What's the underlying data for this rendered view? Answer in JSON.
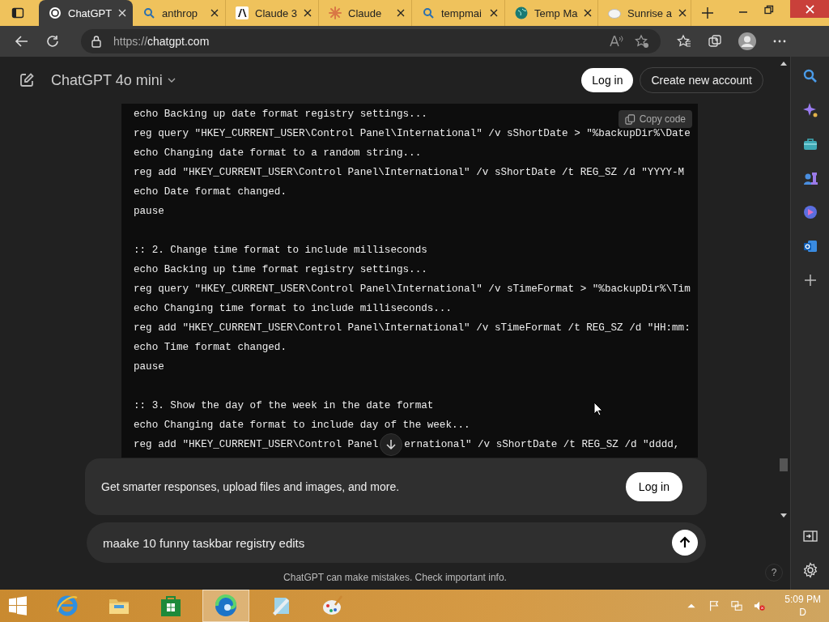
{
  "tabs": [
    {
      "label": "ChatGPT",
      "selected": true
    },
    {
      "label": "anthrop",
      "selected": false
    },
    {
      "label": "Claude 3",
      "selected": false
    },
    {
      "label": "Claude",
      "selected": false
    },
    {
      "label": "tempmai",
      "selected": false
    },
    {
      "label": "Temp Ma",
      "selected": false
    },
    {
      "label": "Sunrise a",
      "selected": false
    }
  ],
  "address_bar": {
    "scheme": "https://",
    "host": "chatgpt.com"
  },
  "header": {
    "model": "ChatGPT 4o mini",
    "login": "Log in",
    "signup": "Create new account"
  },
  "code": {
    "copy": "Copy code",
    "blocks": [
      [
        "echo Backing up date format registry settings...",
        "reg query \"HKEY_CURRENT_USER\\Control Panel\\International\" /v sShortDate > \"%backupDir%\\Date",
        "echo Changing date format to a random string...",
        "reg add \"HKEY_CURRENT_USER\\Control Panel\\International\" /v sShortDate /t REG_SZ /d \"YYYY-M",
        "echo Date format changed.",
        "pause"
      ],
      [
        ":: 2. Change time format to include milliseconds",
        "echo Backing up time format registry settings...",
        "reg query \"HKEY_CURRENT_USER\\Control Panel\\International\" /v sTimeFormat > \"%backupDir%\\Tim",
        "echo Changing time format to include milliseconds...",
        "reg add \"HKEY_CURRENT_USER\\Control Panel\\International\" /v sTimeFormat /t REG_SZ /d \"HH:mm:",
        "echo Time format changed.",
        "pause"
      ],
      [
        ":: 3. Show the day of the week in the date format",
        "echo Changing date format to include day of the week..."
      ]
    ],
    "partial_line": {
      "before": "reg add \"HKEY_CURRENT_USER\\Control Panel",
      "after": "ernational\" /v sShortDate /t REG_SZ /d \"dddd,"
    }
  },
  "banner": {
    "text": "Get smarter responses, upload files and images, and more.",
    "button": "Log in"
  },
  "composer": {
    "value": "maake 10 funny taskbar registry edits "
  },
  "disclaimer": "ChatGPT can make mistakes. Check important info.",
  "help": "?",
  "taskbar": {
    "apps": [
      {
        "active": false
      },
      {
        "active": false
      },
      {
        "active": false
      },
      {
        "active": true
      },
      {
        "active": false
      },
      {
        "active": false
      }
    ],
    "time": "5:09 PM",
    "date": "D"
  }
}
